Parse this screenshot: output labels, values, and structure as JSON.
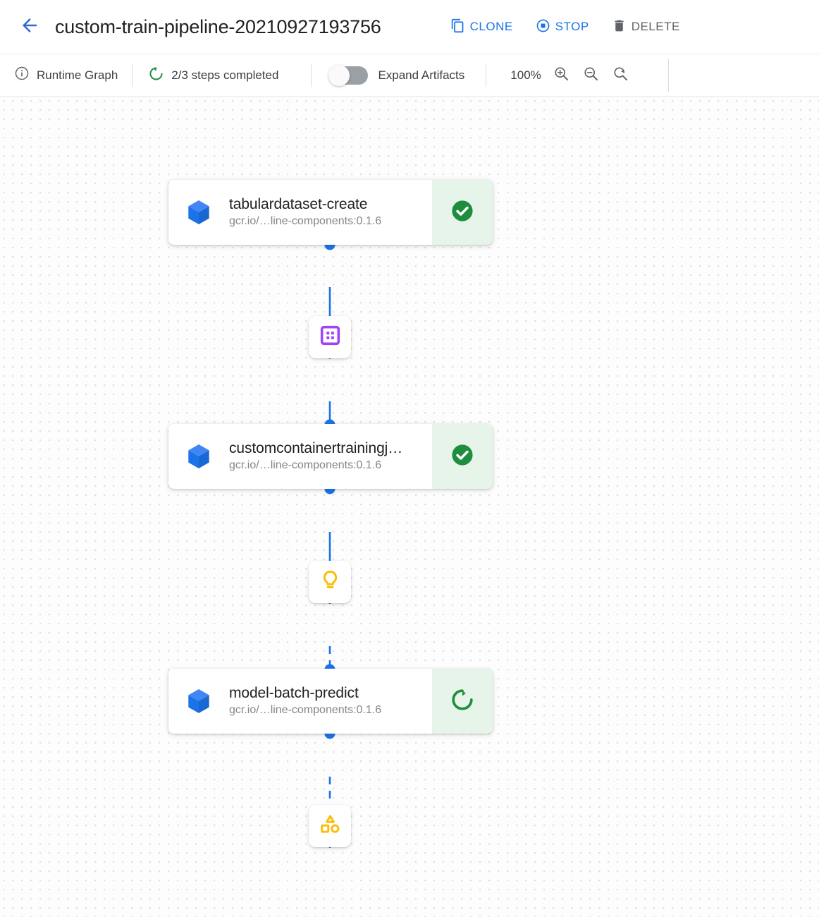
{
  "header": {
    "back_icon": "arrow-back-icon",
    "title": "custom-train-pipeline-20210927193756",
    "actions": [
      {
        "id": "clone",
        "label": "CLONE",
        "icon": "copy-icon",
        "style": "blue"
      },
      {
        "id": "stop",
        "label": "STOP",
        "icon": "stop-circle-icon",
        "style": "blue"
      },
      {
        "id": "delete",
        "label": "DELETE",
        "icon": "trash-icon",
        "style": "grey"
      }
    ]
  },
  "toolbar": {
    "runtime_graph": {
      "label": "Runtime Graph",
      "icon": "info-circle-icon"
    },
    "steps": {
      "label": "2/3 steps completed",
      "icon": "progress-circle-icon",
      "icon_color": "#1e8e3e"
    },
    "expand_artifacts": {
      "label": "Expand Artifacts",
      "checked": false
    },
    "zoom_level": "100%",
    "zoom_in": {
      "icon": "zoom-in-icon"
    },
    "zoom_out": {
      "icon": "zoom-out-icon"
    },
    "zoom_reset": {
      "icon": "zoom-reset-icon"
    }
  },
  "graph": {
    "nodes": [
      {
        "id": "tabulardataset-create",
        "title": "tabulardataset-create",
        "subtitle": "gcr.io/…line-components:0.1.6",
        "icon": "cube-icon",
        "status": "succeeded",
        "status_icon": "check-circle-filled-icon",
        "status_color": "#1e8e3e",
        "status_bg": "#e6f4ea"
      },
      {
        "id": "customcontainertrainingjob",
        "title": "customcontainertrainingj…",
        "subtitle": "gcr.io/…line-components:0.1.6",
        "icon": "cube-icon",
        "status": "succeeded",
        "status_icon": "check-circle-filled-icon",
        "status_color": "#1e8e3e",
        "status_bg": "#e6f4ea"
      },
      {
        "id": "model-batch-predict",
        "title": "model-batch-predict",
        "subtitle": "gcr.io/…line-components:0.1.6",
        "icon": "cube-icon",
        "status": "running",
        "status_icon": "refresh-circle-icon",
        "status_color": "#1e8e3e",
        "status_bg": "#e6f4ea"
      }
    ],
    "artifacts": [
      {
        "id": "dataset-artifact",
        "icon": "dataset-squares-icon",
        "color": "#a142f4"
      },
      {
        "id": "model-artifact",
        "icon": "lightbulb-icon",
        "color": "#fbbc04"
      },
      {
        "id": "batch-prediction-artifact",
        "icon": "shapes-icon",
        "color": "#fbbc04"
      }
    ],
    "edges": [
      {
        "from": "tabulardataset-create",
        "to": "dataset-artifact",
        "style": "solid"
      },
      {
        "from": "dataset-artifact",
        "to": "customcontainertrainingjob",
        "style": "solid"
      },
      {
        "from": "customcontainertrainingjob",
        "to": "model-artifact",
        "style": "solid"
      },
      {
        "from": "model-artifact",
        "to": "model-batch-predict",
        "style": "dashed"
      },
      {
        "from": "model-batch-predict",
        "to": "batch-prediction-artifact",
        "style": "dashed"
      }
    ],
    "edge_color": "#1a73e8"
  }
}
